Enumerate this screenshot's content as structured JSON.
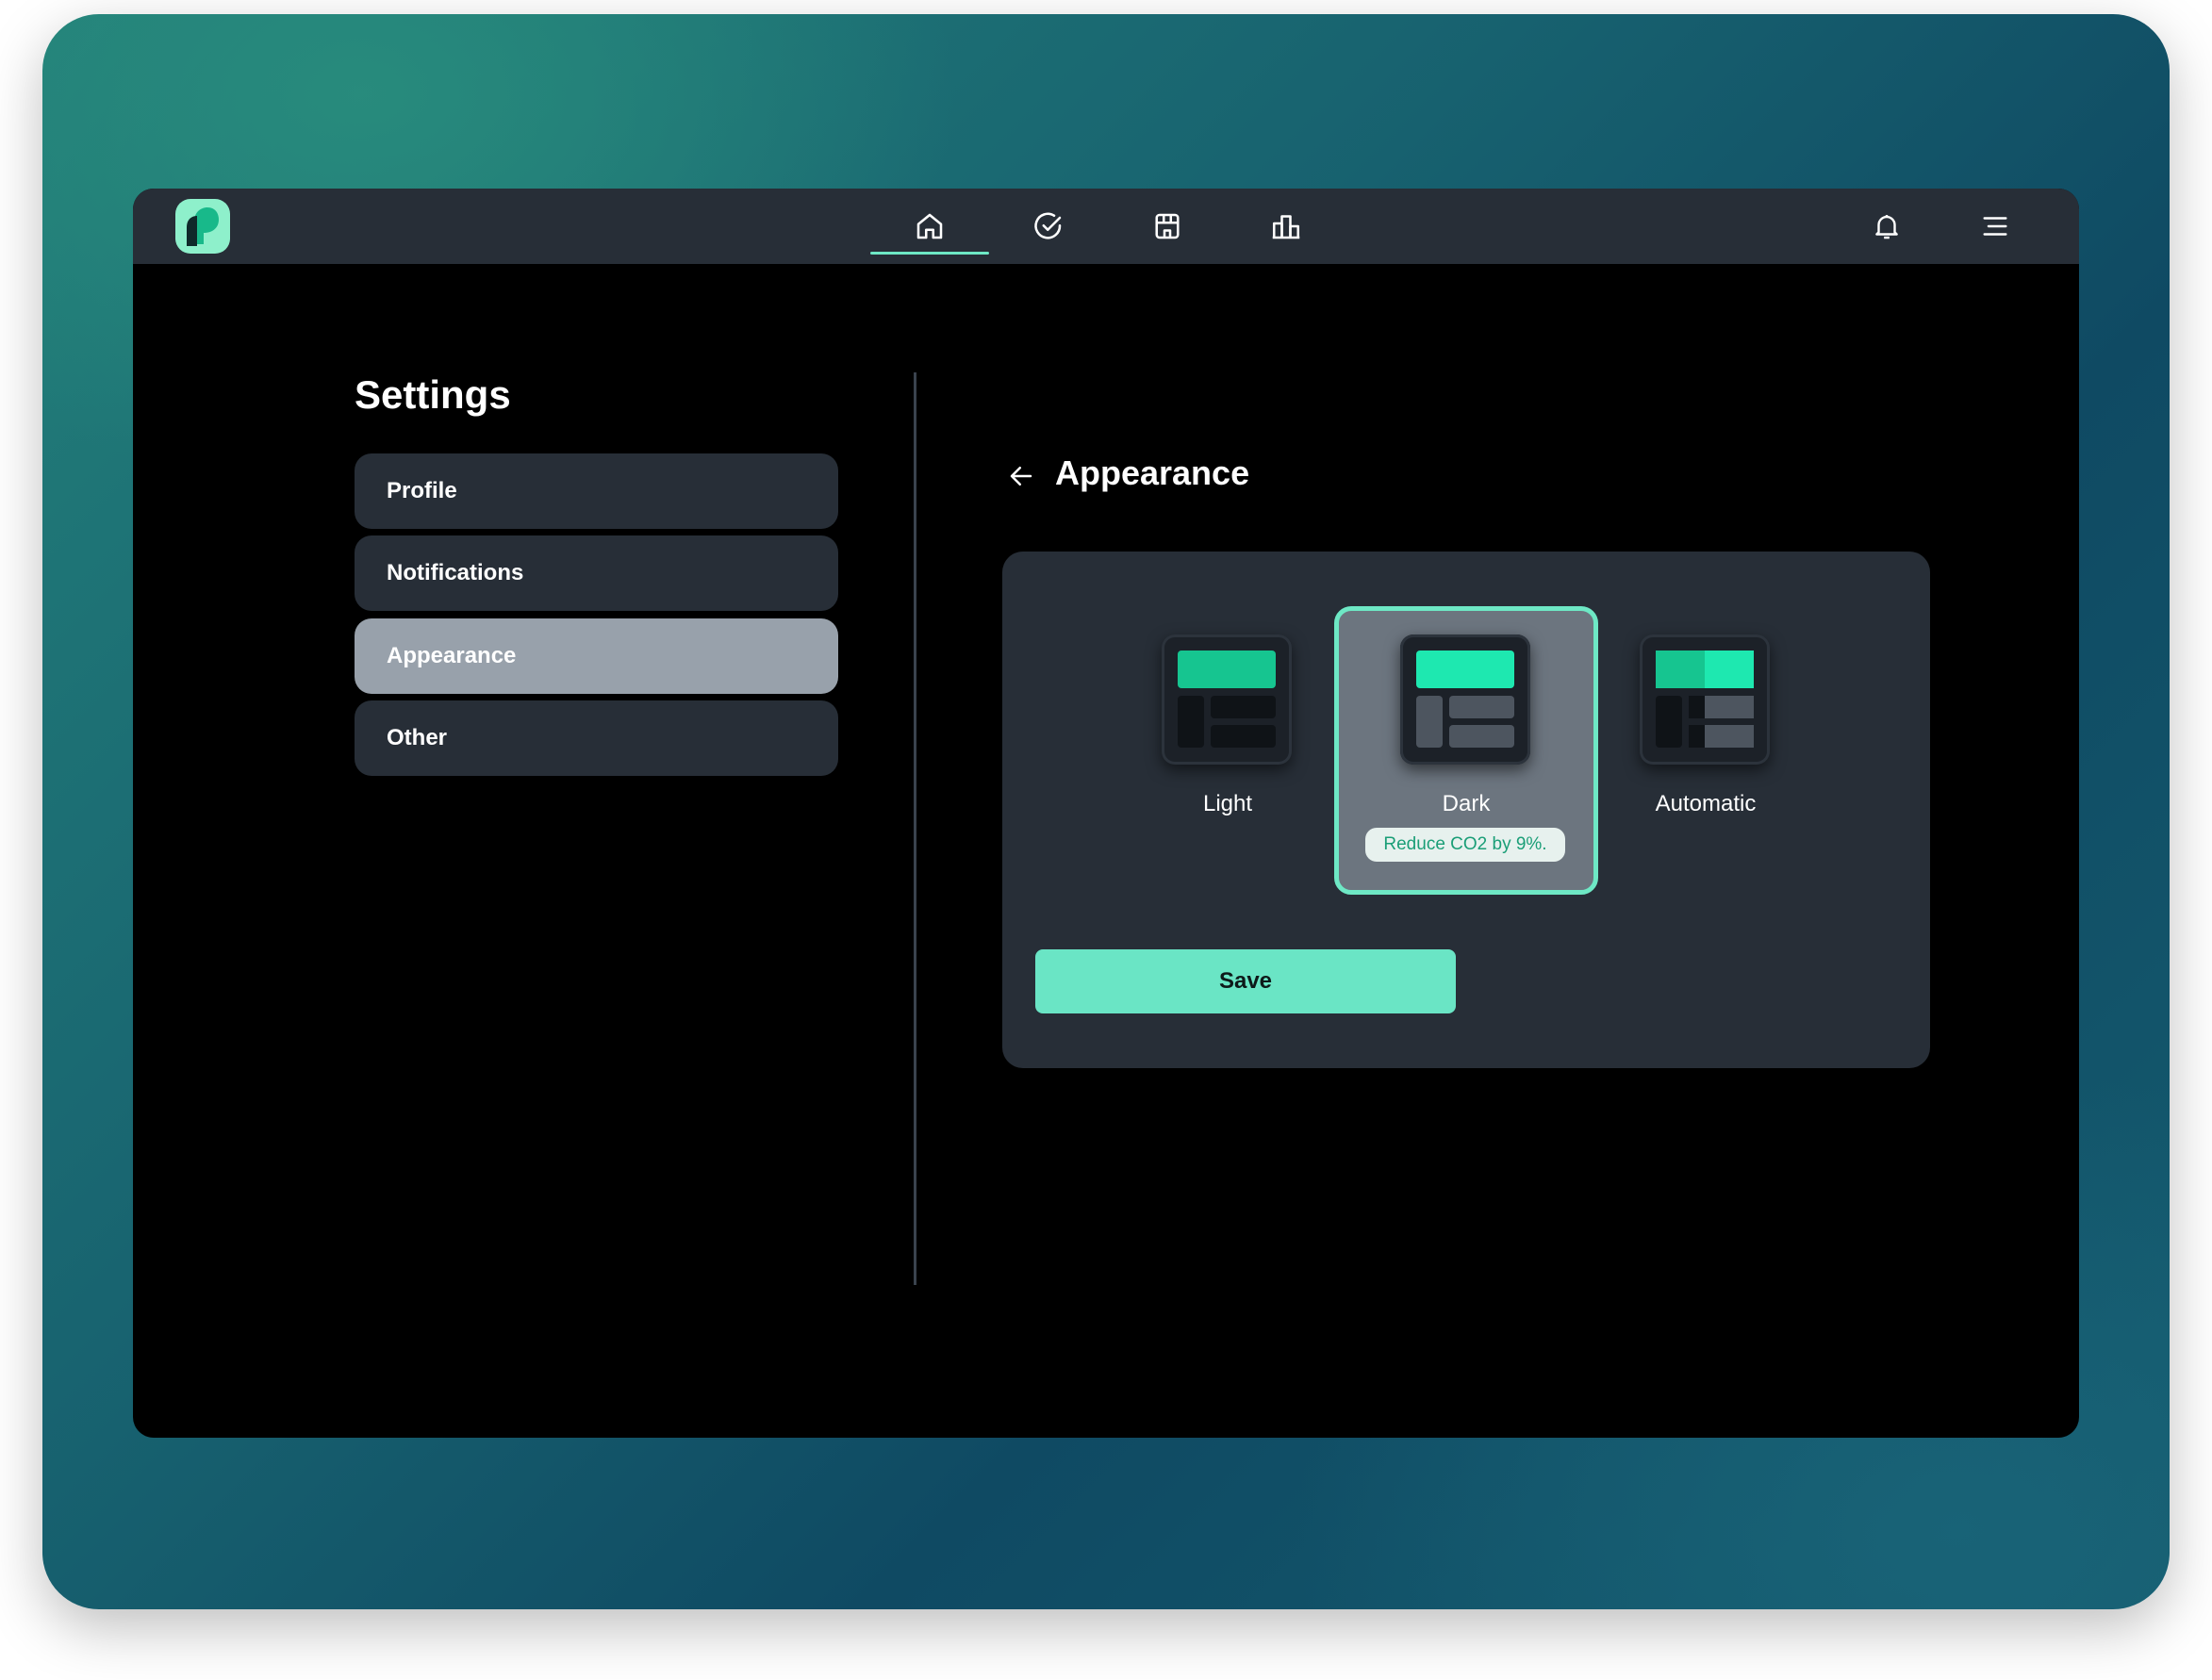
{
  "colors": {
    "accent": "#6ee8c5",
    "topbar": "#272e37",
    "panel": "#272e37",
    "menu_active": "#98a1ab"
  },
  "topbar": {
    "nav": [
      {
        "icon": "home-icon",
        "active": true
      },
      {
        "icon": "check-circle-icon",
        "active": false
      },
      {
        "icon": "store-icon",
        "active": false
      },
      {
        "icon": "buildings-icon",
        "active": false
      }
    ],
    "right_icons": [
      "bell-icon",
      "menu-icon"
    ]
  },
  "settings": {
    "title": "Settings",
    "menu": [
      {
        "label": "Profile",
        "active": false
      },
      {
        "label": "Notifications",
        "active": false
      },
      {
        "label": "Appearance",
        "active": true
      },
      {
        "label": "Other",
        "active": false
      }
    ]
  },
  "appearance": {
    "title": "Appearance",
    "options": [
      {
        "label": "Light",
        "selected": false
      },
      {
        "label": "Dark",
        "selected": true,
        "badge": "Reduce CO2 by 9%."
      },
      {
        "label": "Automatic",
        "selected": false
      }
    ],
    "save_label": "Save"
  }
}
